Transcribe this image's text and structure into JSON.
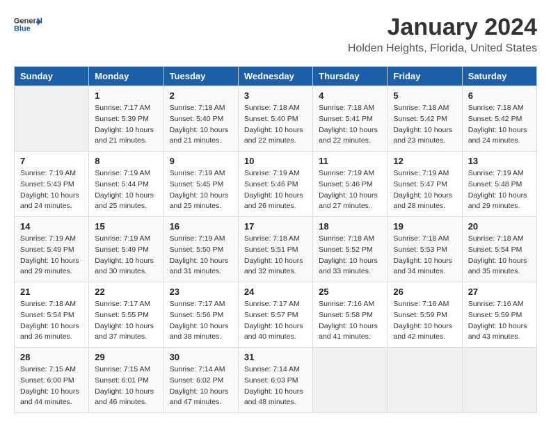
{
  "header": {
    "logo_line1": "General",
    "logo_line2": "Blue",
    "month": "January 2024",
    "location": "Holden Heights, Florida, United States"
  },
  "weekdays": [
    "Sunday",
    "Monday",
    "Tuesday",
    "Wednesday",
    "Thursday",
    "Friday",
    "Saturday"
  ],
  "weeks": [
    [
      {
        "day": "",
        "info": ""
      },
      {
        "day": "1",
        "info": "Sunrise: 7:17 AM\nSunset: 5:39 PM\nDaylight: 10 hours\nand 21 minutes."
      },
      {
        "day": "2",
        "info": "Sunrise: 7:18 AM\nSunset: 5:40 PM\nDaylight: 10 hours\nand 21 minutes."
      },
      {
        "day": "3",
        "info": "Sunrise: 7:18 AM\nSunset: 5:40 PM\nDaylight: 10 hours\nand 22 minutes."
      },
      {
        "day": "4",
        "info": "Sunrise: 7:18 AM\nSunset: 5:41 PM\nDaylight: 10 hours\nand 22 minutes."
      },
      {
        "day": "5",
        "info": "Sunrise: 7:18 AM\nSunset: 5:42 PM\nDaylight: 10 hours\nand 23 minutes."
      },
      {
        "day": "6",
        "info": "Sunrise: 7:18 AM\nSunset: 5:42 PM\nDaylight: 10 hours\nand 24 minutes."
      }
    ],
    [
      {
        "day": "7",
        "info": "Sunrise: 7:19 AM\nSunset: 5:43 PM\nDaylight: 10 hours\nand 24 minutes."
      },
      {
        "day": "8",
        "info": "Sunrise: 7:19 AM\nSunset: 5:44 PM\nDaylight: 10 hours\nand 25 minutes."
      },
      {
        "day": "9",
        "info": "Sunrise: 7:19 AM\nSunset: 5:45 PM\nDaylight: 10 hours\nand 25 minutes."
      },
      {
        "day": "10",
        "info": "Sunrise: 7:19 AM\nSunset: 5:46 PM\nDaylight: 10 hours\nand 26 minutes."
      },
      {
        "day": "11",
        "info": "Sunrise: 7:19 AM\nSunset: 5:46 PM\nDaylight: 10 hours\nand 27 minutes."
      },
      {
        "day": "12",
        "info": "Sunrise: 7:19 AM\nSunset: 5:47 PM\nDaylight: 10 hours\nand 28 minutes."
      },
      {
        "day": "13",
        "info": "Sunrise: 7:19 AM\nSunset: 5:48 PM\nDaylight: 10 hours\nand 29 minutes."
      }
    ],
    [
      {
        "day": "14",
        "info": "Sunrise: 7:19 AM\nSunset: 5:49 PM\nDaylight: 10 hours\nand 29 minutes."
      },
      {
        "day": "15",
        "info": "Sunrise: 7:19 AM\nSunset: 5:49 PM\nDaylight: 10 hours\nand 30 minutes."
      },
      {
        "day": "16",
        "info": "Sunrise: 7:19 AM\nSunset: 5:50 PM\nDaylight: 10 hours\nand 31 minutes."
      },
      {
        "day": "17",
        "info": "Sunrise: 7:18 AM\nSunset: 5:51 PM\nDaylight: 10 hours\nand 32 minutes."
      },
      {
        "day": "18",
        "info": "Sunrise: 7:18 AM\nSunset: 5:52 PM\nDaylight: 10 hours\nand 33 minutes."
      },
      {
        "day": "19",
        "info": "Sunrise: 7:18 AM\nSunset: 5:53 PM\nDaylight: 10 hours\nand 34 minutes."
      },
      {
        "day": "20",
        "info": "Sunrise: 7:18 AM\nSunset: 5:54 PM\nDaylight: 10 hours\nand 35 minutes."
      }
    ],
    [
      {
        "day": "21",
        "info": "Sunrise: 7:18 AM\nSunset: 5:54 PM\nDaylight: 10 hours\nand 36 minutes."
      },
      {
        "day": "22",
        "info": "Sunrise: 7:17 AM\nSunset: 5:55 PM\nDaylight: 10 hours\nand 37 minutes."
      },
      {
        "day": "23",
        "info": "Sunrise: 7:17 AM\nSunset: 5:56 PM\nDaylight: 10 hours\nand 38 minutes."
      },
      {
        "day": "24",
        "info": "Sunrise: 7:17 AM\nSunset: 5:57 PM\nDaylight: 10 hours\nand 40 minutes."
      },
      {
        "day": "25",
        "info": "Sunrise: 7:16 AM\nSunset: 5:58 PM\nDaylight: 10 hours\nand 41 minutes."
      },
      {
        "day": "26",
        "info": "Sunrise: 7:16 AM\nSunset: 5:59 PM\nDaylight: 10 hours\nand 42 minutes."
      },
      {
        "day": "27",
        "info": "Sunrise: 7:16 AM\nSunset: 5:59 PM\nDaylight: 10 hours\nand 43 minutes."
      }
    ],
    [
      {
        "day": "28",
        "info": "Sunrise: 7:15 AM\nSunset: 6:00 PM\nDaylight: 10 hours\nand 44 minutes."
      },
      {
        "day": "29",
        "info": "Sunrise: 7:15 AM\nSunset: 6:01 PM\nDaylight: 10 hours\nand 46 minutes."
      },
      {
        "day": "30",
        "info": "Sunrise: 7:14 AM\nSunset: 6:02 PM\nDaylight: 10 hours\nand 47 minutes."
      },
      {
        "day": "31",
        "info": "Sunrise: 7:14 AM\nSunset: 6:03 PM\nDaylight: 10 hours\nand 48 minutes."
      },
      {
        "day": "",
        "info": ""
      },
      {
        "day": "",
        "info": ""
      },
      {
        "day": "",
        "info": ""
      }
    ]
  ]
}
